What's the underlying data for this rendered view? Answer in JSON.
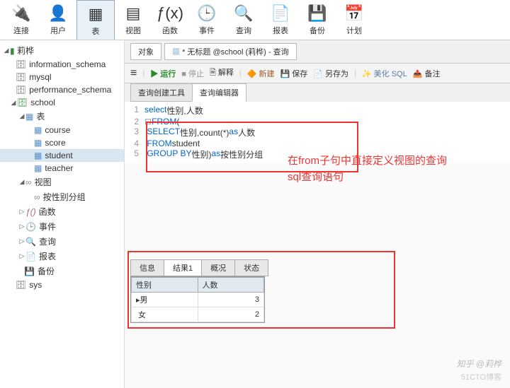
{
  "toolbar": [
    {
      "icon": "🔌",
      "label": "连接"
    },
    {
      "icon": "👤",
      "label": "用户"
    },
    {
      "icon": "▦",
      "label": "表",
      "active": true
    },
    {
      "icon": "▤",
      "label": "视图"
    },
    {
      "icon": "ƒ(x)",
      "label": "函数"
    },
    {
      "icon": "🕒",
      "label": "事件"
    },
    {
      "icon": "🔍",
      "label": "查询"
    },
    {
      "icon": "📄",
      "label": "报表"
    },
    {
      "icon": "💾",
      "label": "备份"
    },
    {
      "icon": "📅",
      "label": "计划"
    }
  ],
  "tree": {
    "root": "莉桦",
    "dbs": [
      "information_schema",
      "mysql",
      "performance_schema"
    ],
    "school": {
      "name": "school",
      "tables_label": "表",
      "tables": [
        "course",
        "score",
        "student",
        "teacher"
      ],
      "view_label": "视图",
      "views": [
        "按性别分组"
      ],
      "fn": "函数",
      "ev": "事件",
      "qr": "查询",
      "rp": "报表",
      "bk": "备份"
    },
    "sys": "sys"
  },
  "tabs": {
    "obj": "对象",
    "query": "* 无标题 @school (莉桦) - 查询"
  },
  "btns": {
    "menu": "≡",
    "run": "▶ 运行",
    "stop": "■ 停止",
    "explain": "🗎 解释",
    "new": "🔶 新建",
    "save": "💾 保存",
    "saveas": "📄 另存为",
    "beautify": "✨ 美化 SQL",
    "export": "📤 备注"
  },
  "subtabs": {
    "builder": "查询创建工具",
    "editor": "查询编辑器"
  },
  "sql": {
    "l1": {
      "kw": "select",
      "rest": " 性别,人数"
    },
    "l2": {
      "kw": "FROM",
      "rest": " ("
    },
    "l3": {
      "kw": "SELECT",
      "rest": " 性别,count(*)",
      "kw2": "as",
      "rest2": " 人数"
    },
    "l4": {
      "kw": "FROM",
      "rest": " student"
    },
    "l5": {
      "kw": "GROUP BY",
      "rest": " 性别) ",
      "kw2": "as",
      "rest2": " 按性别分组"
    }
  },
  "annotation": "在from子句中直接定义视图的查询sql查询语句",
  "result_tabs": [
    "信息",
    "结果1",
    "概况",
    "状态"
  ],
  "chart_data": {
    "type": "table",
    "columns": [
      "性别",
      "人数"
    ],
    "rows": [
      {
        "性别": "男",
        "人数": 3
      },
      {
        "性别": "女",
        "人数": 2
      }
    ]
  },
  "watermark_main": "知乎 @莉桦",
  "watermark_sub": "51CTO博客"
}
